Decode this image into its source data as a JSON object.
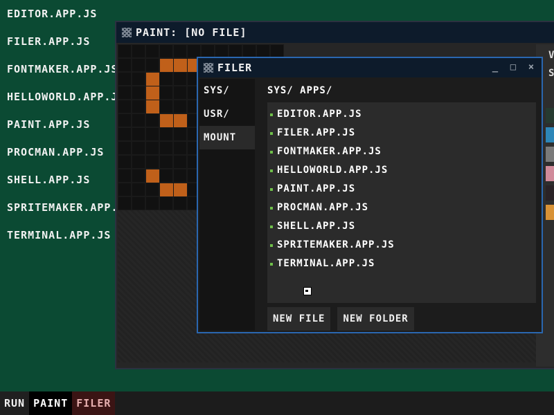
{
  "desktop": {
    "items": [
      "EDITOR.APP.JS",
      "FILER.APP.JS",
      "FONTMAKER.APP.JS",
      "HELLOWORLD.APP.JS",
      "PAINT.APP.JS",
      "PROCMAN.APP.JS",
      "SHELL.APP.JS",
      "SPRITEMAKER.APP.JS",
      "TERMINAL.APP.JS"
    ]
  },
  "paint": {
    "title": "PAINT:  [NO FILE]",
    "panel_letters": [
      "V",
      "S"
    ],
    "swatches": [
      "#263a30",
      "#2d86b8",
      "#7a7a7a",
      "#d08a9a",
      "#2a2226",
      "#d89236"
    ],
    "stroke_color": "#c0601a"
  },
  "filer": {
    "title": "FILER",
    "sidebar": [
      "SYS/",
      "USR/",
      "MOUNT"
    ],
    "path": "SYS/ APPS/",
    "files": [
      "EDITOR.APP.JS",
      "FILER.APP.JS",
      "FONTMAKER.APP.JS",
      "HELLOWORLD.APP.JS",
      "PAINT.APP.JS",
      "PROCMAN.APP.JS",
      "SHELL.APP.JS",
      "SPRITEMAKER.APP.JS",
      "TERMINAL.APP.JS"
    ],
    "new_file": "NEW FILE",
    "new_folder": "NEW FOLDER",
    "controls": {
      "minimize": "_",
      "maximize": "□",
      "close": "×"
    }
  },
  "taskbar": {
    "run": "RUN",
    "paint": "PAINT",
    "filer": "FILER"
  }
}
